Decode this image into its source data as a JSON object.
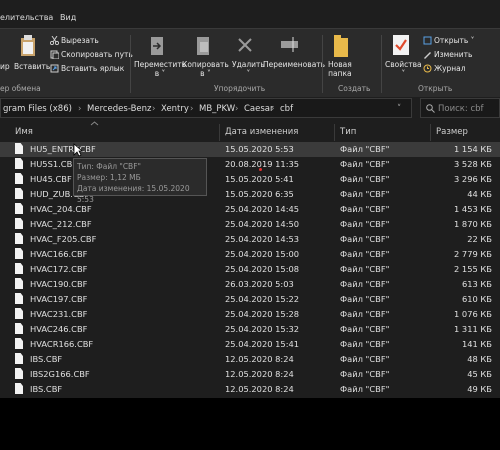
{
  "menu": {
    "items": [
      "елительства",
      "Вид"
    ]
  },
  "ribbon": {
    "clipboard": {
      "copy_path_label": "ир",
      "paste_label": "Вставить",
      "cut_label": "Вырезать",
      "copy_path_btn_label": "Скопировать путь",
      "paste_shortcut_label": "Вставить ярлык",
      "group_label": "ер обмена"
    },
    "organize": {
      "move_label": "Переместить\nв ˅",
      "copy_label": "Копировать\nв ˅",
      "delete_label": "Удалить\n˅",
      "rename_label": "Переименовать",
      "group_label": "Упорядочить"
    },
    "create": {
      "new_folder_label": "Новая\nпапка",
      "group_label": "Создать"
    },
    "open": {
      "properties_label": "Свойства\n˅",
      "open_label": "Открыть ˅",
      "edit_label": "Изменить",
      "history_label": "Журнал",
      "group_label": "Открыть"
    }
  },
  "address": {
    "crumbs": [
      "gram Files (x86)",
      "Mercedes-Benz",
      "Xentry",
      "MB_PKW",
      "Caesar",
      "cbf"
    ],
    "search_placeholder": "Поиск: cbf"
  },
  "columns": {
    "name": "Имя",
    "date": "Дата изменения",
    "type": "Тип",
    "size": "Размер"
  },
  "files": [
    {
      "name": "HU5_ENTRY.CBF",
      "date": "15.05.2020 5:53",
      "type": "Файл \"CBF\"",
      "size": "1 154 КБ"
    },
    {
      "name": "HU5S1.CBF",
      "date": "20.08.2019 11:35",
      "type": "Файл \"CBF\"",
      "size": "3 528 КБ"
    },
    {
      "name": "HU45.CBF",
      "date": "15.05.2020 5:41",
      "type": "Файл \"CBF\"",
      "size": "3 296 КБ"
    },
    {
      "name": "HUD_ZUB.CBF",
      "date": "15.05.2020 6:35",
      "type": "Файл \"CBF\"",
      "size": "44 КБ"
    },
    {
      "name": "HVAC_204.CBF",
      "date": "25.04.2020 14:45",
      "type": "Файл \"CBF\"",
      "size": "1 453 КБ"
    },
    {
      "name": "HVAC_212.CBF",
      "date": "25.04.2020 14:50",
      "type": "Файл \"CBF\"",
      "size": "1 870 КБ"
    },
    {
      "name": "HVAC_F205.CBF",
      "date": "25.04.2020 14:53",
      "type": "Файл \"CBF\"",
      "size": "22 КБ"
    },
    {
      "name": "HVAC166.CBF",
      "date": "25.04.2020 15:00",
      "type": "Файл \"CBF\"",
      "size": "2 779 КБ"
    },
    {
      "name": "HVAC172.CBF",
      "date": "25.04.2020 15:08",
      "type": "Файл \"CBF\"",
      "size": "2 155 КБ"
    },
    {
      "name": "HVAC190.CBF",
      "date": "26.03.2020 5:03",
      "type": "Файл \"CBF\"",
      "size": "613 КБ"
    },
    {
      "name": "HVAC197.CBF",
      "date": "25.04.2020 15:22",
      "type": "Файл \"CBF\"",
      "size": "610 КБ"
    },
    {
      "name": "HVAC231.CBF",
      "date": "25.04.2020 15:28",
      "type": "Файл \"CBF\"",
      "size": "1 076 КБ"
    },
    {
      "name": "HVAC246.CBF",
      "date": "25.04.2020 15:32",
      "type": "Файл \"CBF\"",
      "size": "1 311 КБ"
    },
    {
      "name": "HVACR166.CBF",
      "date": "25.04.2020 15:41",
      "type": "Файл \"CBF\"",
      "size": "141 КБ"
    },
    {
      "name": "IBS.CBF",
      "date": "12.05.2020 8:24",
      "type": "Файл \"CBF\"",
      "size": "48 КБ"
    },
    {
      "name": "IBS2G166.CBF",
      "date": "12.05.2020 8:24",
      "type": "Файл \"CBF\"",
      "size": "45 КБ"
    },
    {
      "name": "IBS.CBF",
      "date": "12.05.2020 8:24",
      "type": "Файл \"CBF\"",
      "size": "49 КБ"
    }
  ],
  "tooltip": {
    "type_line": "Тип: Файл \"CBF\"",
    "size_line": "Размер: 1,12 МБ",
    "date_line": "Дата изменения: 15.05.2020 5:53"
  }
}
